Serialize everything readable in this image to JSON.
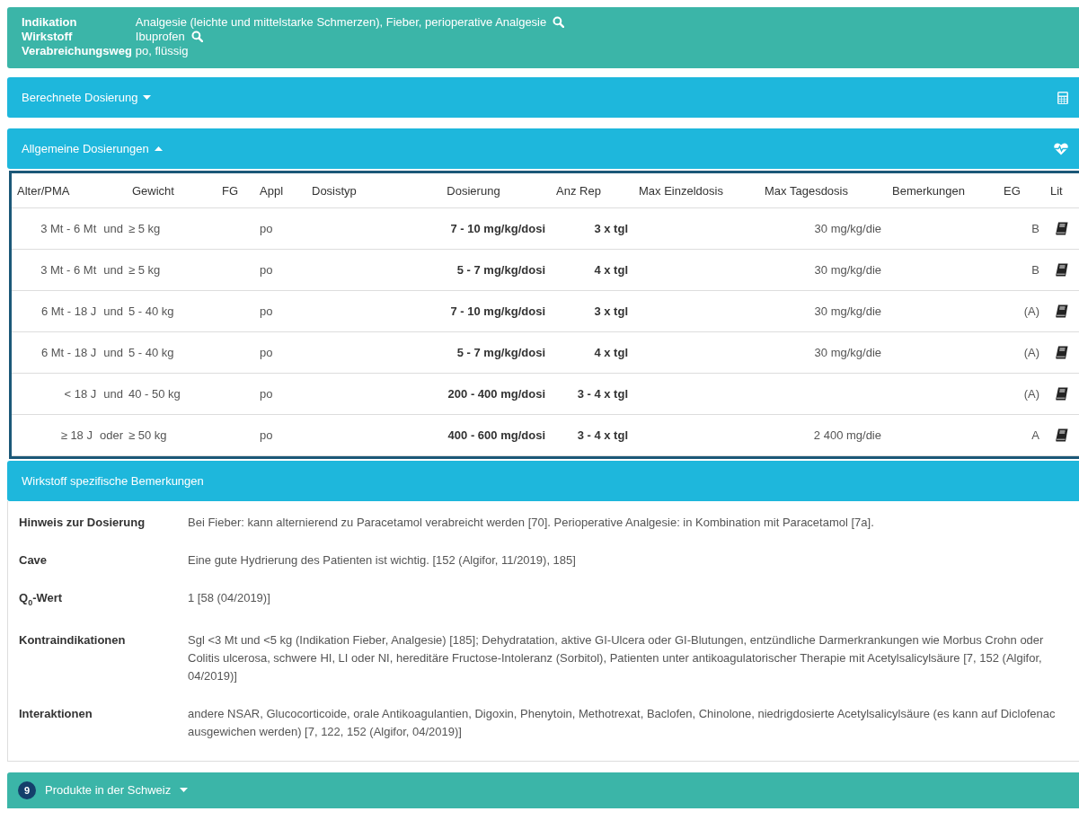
{
  "summary": [
    {
      "label": "Indikation",
      "value": "Analgesie (leichte und mittelstarke Schmerzen), Fieber, perioperative Analgesie",
      "searchable": true
    },
    {
      "label": "Wirkstoff",
      "value": "Ibuprofen",
      "searchable": true
    },
    {
      "label": "Verabreichungsweg",
      "value": "po, flüssig",
      "searchable": false
    }
  ],
  "calculated_panel": {
    "title": "Berechnete Dosierung",
    "expanded": false
  },
  "general_panel": {
    "title": "Allgemeine Dosierungen",
    "expanded": true
  },
  "table": {
    "columns": [
      "Alter/PMA",
      "Gewicht",
      "FG",
      "Appl",
      "Dosistyp",
      "Dosierung",
      "Anz Rep",
      "Max Einzeldosis",
      "Max Tagesdosis",
      "Bemerkungen",
      "EG",
      "Lit"
    ],
    "rows": [
      {
        "age": "3 Mt - 6 Mt",
        "conj": "und",
        "weight": "≥ 5 kg",
        "appl": "po",
        "dose": "7 - 10 mg/kg/dosi",
        "reps": "3 x tgl",
        "max_day": "30 mg/kg/die",
        "eg": "B"
      },
      {
        "age": "3 Mt - 6 Mt",
        "conj": "und",
        "weight": "≥ 5 kg",
        "appl": "po",
        "dose": "5 - 7 mg/kg/dosi",
        "reps": "4 x tgl",
        "max_day": "30 mg/kg/die",
        "eg": "B"
      },
      {
        "age": "6 Mt - 18 J",
        "conj": "und",
        "weight": "5 - 40 kg",
        "appl": "po",
        "dose": "7 - 10 mg/kg/dosi",
        "reps": "3 x tgl",
        "max_day": "30 mg/kg/die",
        "eg": "(A)"
      },
      {
        "age": "6 Mt - 18 J",
        "conj": "und",
        "weight": "5 - 40 kg",
        "appl": "po",
        "dose": "5 - 7 mg/kg/dosi",
        "reps": "4 x tgl",
        "max_day": "30 mg/kg/die",
        "eg": "(A)"
      },
      {
        "age": "< 18 J",
        "conj": "und",
        "weight": "40 - 50 kg",
        "appl": "po",
        "dose": "200 - 400 mg/dosi",
        "reps": "3 - 4 x tgl",
        "eg": "(A)"
      },
      {
        "age": "≥ 18 J",
        "conj": "oder",
        "weight": "≥ 50 kg",
        "appl": "po",
        "dose": "400 - 600 mg/dosi",
        "reps": "3 - 4 x tgl",
        "max_day": "2 400 mg/die",
        "eg": "A"
      }
    ]
  },
  "remarks_panel": {
    "title": "Wirkstoff spezifische Bemerkungen",
    "items": [
      {
        "label": "Hinweis zur Dosierung",
        "text": "Bei Fieber: kann alternierend zu Paracetamol verabreicht werden [70]. Perioperative Analgesie: in Kombination mit Paracetamol [7a]."
      },
      {
        "label": "Cave",
        "text": "Eine gute Hydrierung des Patienten ist wichtig. [152 (Algifor, 11/2019), 185]"
      },
      {
        "label": "Q$_{0}$-Wert",
        "text": "1 [58 (04/2019)]"
      },
      {
        "label": "Kontraindikationen",
        "text": "Sgl <3 Mt und <5 kg (Indikation Fieber, Analgesie) [185]; Dehydratation, aktive GI-Ulcera oder GI-Blutungen, entzündliche Darmerkrankungen wie Morbus Crohn oder Colitis ulcerosa, schwere HI, LI oder NI, hereditäre Fructose-Intoleranz (Sorbitol), Patienten unter antikoagulatorischer Therapie mit Acetylsalicylsäure [7, 152 (Algifor, 04/2019)]"
      },
      {
        "label": "Interaktionen",
        "text": "andere NSAR, Glucocorticoide, orale Antikoagulantien, Digoxin, Phenytoin, Methotrexat, Baclofen, Chinolone, niedrigdosierte Acetylsalicylsäure (es kann auf Diclofenac ausgewichen werden) [7, 122, 152 (Algifor, 04/2019)]"
      }
    ]
  },
  "products_panel": {
    "count": "9",
    "title": "Produkte in der Schweiz",
    "expanded": false
  }
}
